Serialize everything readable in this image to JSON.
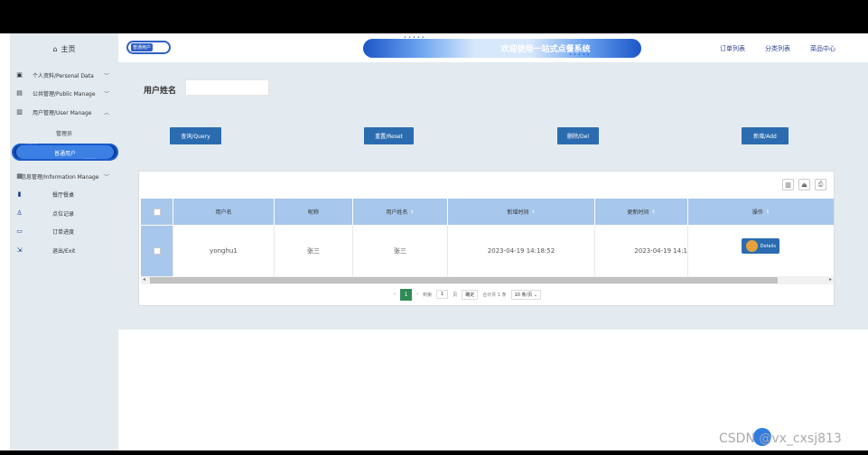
{
  "sidebar": {
    "home_label": "主页",
    "menu": [
      {
        "label": "个人资料/Personal Data",
        "icon": "profile-icon"
      },
      {
        "label": "公共管理/Public Manage",
        "icon": "document-icon"
      },
      {
        "label": "用户管理/User Manage",
        "icon": "user-manage-icon"
      },
      {
        "label": "信息管理/Information Manage",
        "icon": "info-icon"
      }
    ],
    "sub_user": [
      "管理员",
      "普通用户"
    ],
    "sub_info": [
      {
        "label": "餐厅餐桌",
        "icon": "bookmark-icon"
      },
      {
        "label": "点位记录",
        "icon": "person-icon"
      },
      {
        "label": "订单进度",
        "icon": "calendar-icon"
      },
      {
        "label": "退出/Exit",
        "icon": "exit-icon"
      }
    ]
  },
  "header": {
    "breadcrumb": "普通用户",
    "title": "欢迎使用一站式点餐系统",
    "nav": [
      "订单列表",
      "分类列表",
      "菜品中心"
    ]
  },
  "form": {
    "label": "用户姓名",
    "value": ""
  },
  "buttons": {
    "query": "查询/Query",
    "reset": "重置/Reset",
    "delete": "删除/Del",
    "add": "新增/Add"
  },
  "table": {
    "headers": [
      "用户名",
      "昵称",
      "用户姓名",
      "新增时间",
      "更新时间",
      "操作"
    ],
    "rows": [
      {
        "username": "yonghu1",
        "nickname": "张三",
        "realname": "张三",
        "created": "2023-04-19 14:18:52",
        "updated": "2023-04-19 14:1",
        "action": "Details"
      }
    ]
  },
  "pagination": {
    "current": "1",
    "goto_label": "到第",
    "page_input": "1",
    "page_unit": "页",
    "confirm": "确定",
    "total": "合计共 1 条",
    "page_size": "10 条/页"
  },
  "watermark": "CSDN @vx_cxsj813",
  "colors": {
    "sidebar_bg": "#e3eaf0",
    "primary": "#2b6cb0",
    "table_header": "#a7c7ec",
    "accent": "#2e5fc7"
  }
}
